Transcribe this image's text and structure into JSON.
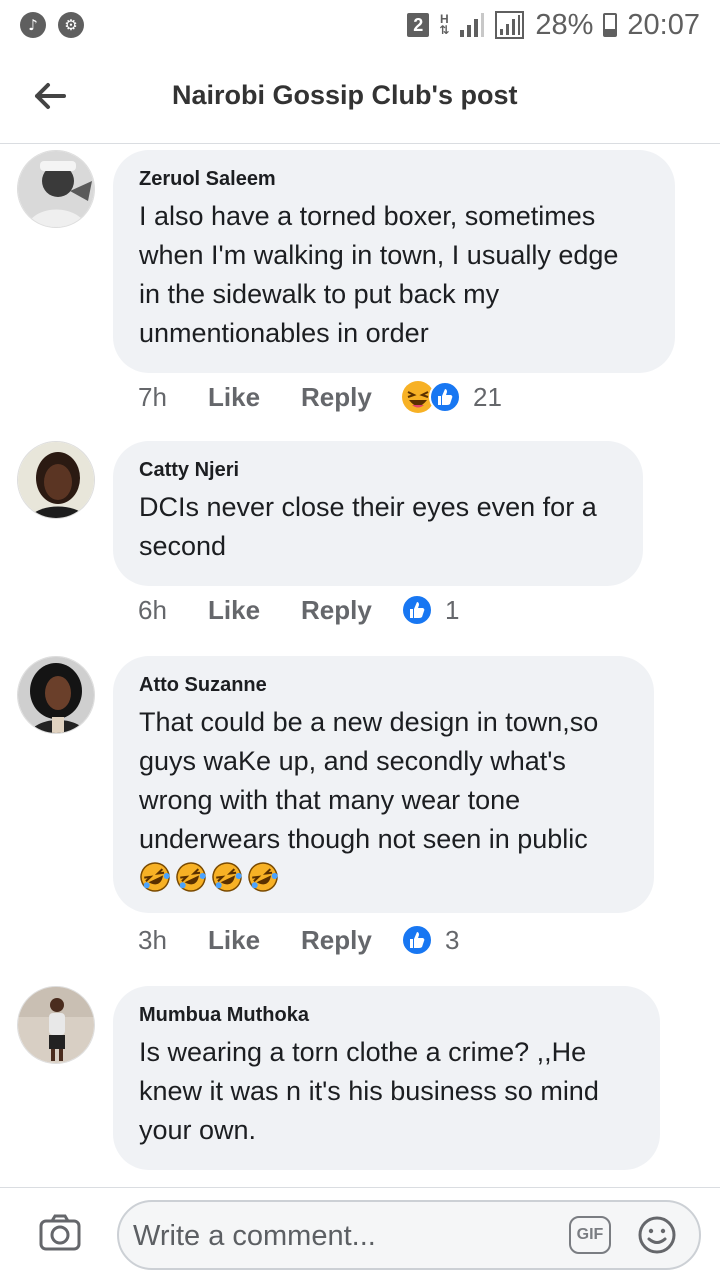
{
  "status_bar": {
    "sim": "2",
    "network": "H",
    "battery": "28%",
    "time": "20:07"
  },
  "header": {
    "back_icon": "arrow-left-icon",
    "title": "Nairobi Gossip Club's post"
  },
  "comments": [
    {
      "author": "Zeruol Saleem",
      "text": "I also have a torned boxer, sometimes\nwhen I'm walking in town, I usually edge\nin the sidewalk to put back my\nunmentionables in order",
      "time": "7h",
      "like": "Like",
      "reply": "Reply",
      "reactions": [
        "haha",
        "like"
      ],
      "reaction_count": "21"
    },
    {
      "author": "Catty Njeri",
      "text": "DCIs never close their eyes even for a\nsecond",
      "time": "6h",
      "like": "Like",
      "reply": "Reply",
      "reactions": [
        "like"
      ],
      "reaction_count": "1"
    },
    {
      "author": "Atto Suzanne",
      "text": "That could be a new design in town,so\nguys waKe up, and secondly  what's\nwrong with that many wear tone\nunderwears though not seen in public",
      "emojis": [
        "rolling-laughing",
        "rolling-laughing",
        "rolling-laughing",
        "rolling-laughing"
      ],
      "time": "3h",
      "like": "Like",
      "reply": "Reply",
      "reactions": [
        "like"
      ],
      "reaction_count": "3"
    },
    {
      "author": "Mumbua Muthoka",
      "text": "Is wearing a torn  clothe a crime? ,,He\nknew it was n it's his business so mind\nyour own.",
      "time": "",
      "like": "",
      "reply": "",
      "reactions": [],
      "reaction_count": ""
    }
  ],
  "composer": {
    "placeholder": "Write a comment...",
    "gif_label": "GIF",
    "camera_icon": "camera-icon",
    "emoji_icon": "smiley-icon"
  },
  "colors": {
    "bubble": "#f0f2f5",
    "like_blue": "#1877f2",
    "haha_yellow": "#f7b125",
    "text": "#1c1e21",
    "meta": "#65676b"
  }
}
